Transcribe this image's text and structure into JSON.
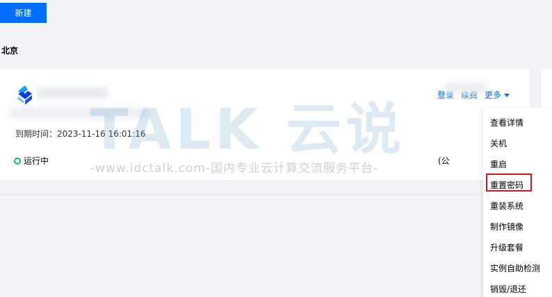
{
  "toolbar": {
    "new_label": "新建"
  },
  "region": {
    "title": "北京"
  },
  "instance": {
    "expire_label": "到期时间：",
    "expire_time": "2023-11-16 16:01:16",
    "status": "运行中",
    "ip_paren": "(公",
    "actions": {
      "login": "登录",
      "renew": "续费",
      "more": "更多"
    }
  },
  "menu": {
    "items": [
      {
        "label": "查看详情"
      },
      {
        "label": "关机"
      },
      {
        "label": "重启"
      },
      {
        "label": "重置密码"
      },
      {
        "label": "重装系统"
      },
      {
        "label": "制作镜像"
      },
      {
        "label": "升级套餐"
      },
      {
        "label": "实例自助检测"
      },
      {
        "label": "销毁/退还"
      }
    ]
  },
  "watermark": {
    "brand": "TALK 云说",
    "tagline": "-www.idctalk.com-国内专业云计算交流服务平台-"
  },
  "colors": {
    "primary": "#006eff",
    "status_running": "#0abf5b",
    "highlight": "#d9131a"
  }
}
